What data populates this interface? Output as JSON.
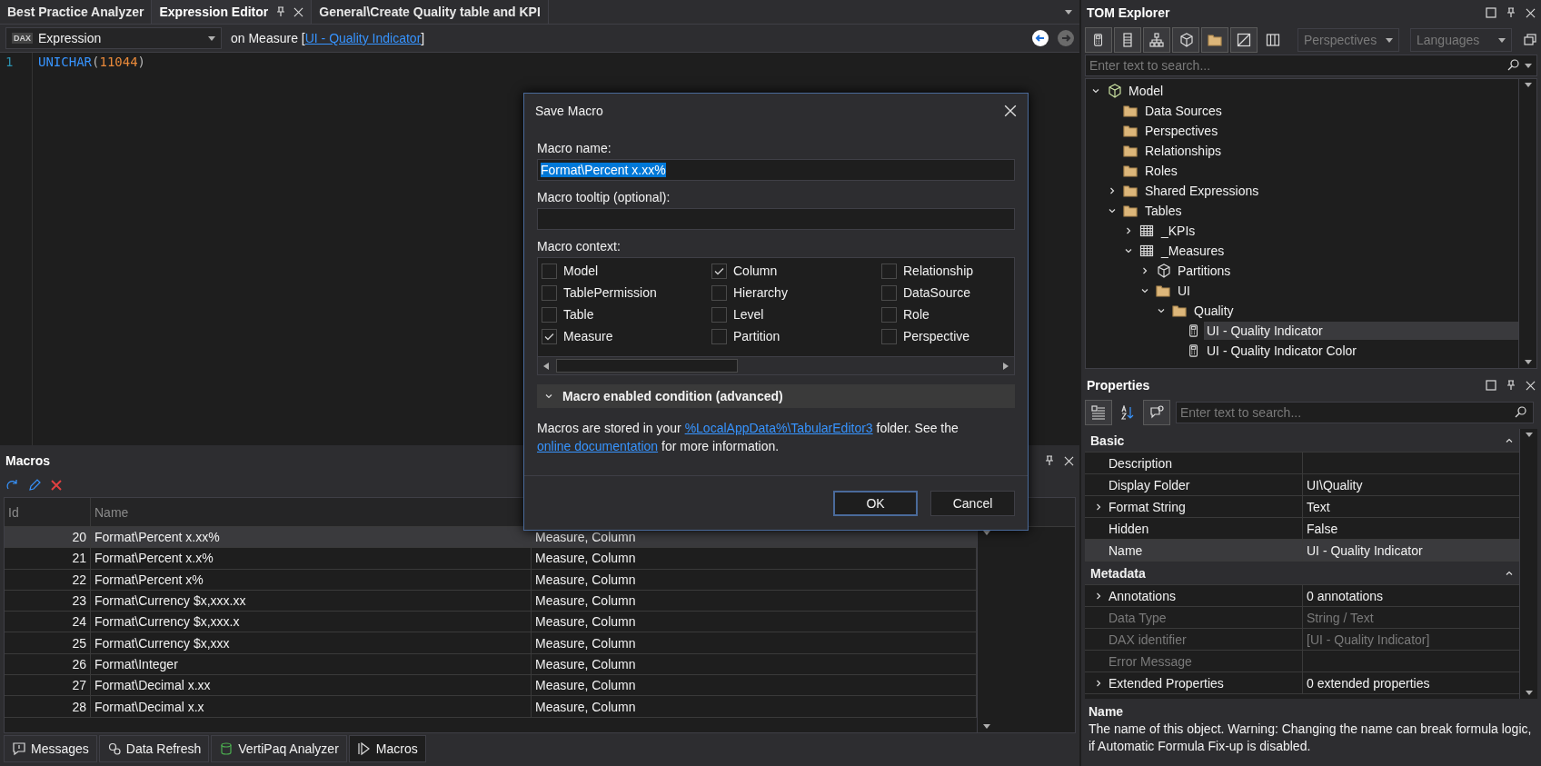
{
  "document_tabs": [
    {
      "label": "Best Practice Analyzer",
      "selected": false,
      "kind": "plain"
    },
    {
      "label": "Expression Editor",
      "selected": true,
      "kind": "pinned"
    },
    {
      "label": "General\\Create Quality table and KPI",
      "selected": false,
      "kind": "plain"
    }
  ],
  "editor": {
    "badge": "DAX",
    "property": "Expression",
    "context_prefix": "on Measure [",
    "context_link": "UI - Quality Indicator",
    "context_suffix": "]",
    "nav_buttons": [
      {
        "kind": "back",
        "disabled": false
      },
      {
        "kind": "forward",
        "disabled": true
      }
    ],
    "lines": [
      {
        "number": "1",
        "tokens": [
          {
            "text": "UNICHAR",
            "kind": "function"
          },
          {
            "text": "(",
            "kind": "paren"
          },
          {
            "text": "11044",
            "kind": "number"
          },
          {
            "text": ")",
            "kind": "paren"
          }
        ]
      }
    ]
  },
  "macros": {
    "title": "Macros",
    "columns": [
      "Id",
      "Name"
    ],
    "rows": [
      {
        "id": "20",
        "name": "Format\\Percent x.xx%",
        "context": "Measure, Column",
        "selected": true
      },
      {
        "id": "21",
        "name": "Format\\Percent x.x%",
        "context": "Measure, Column",
        "selected": false
      },
      {
        "id": "22",
        "name": "Format\\Percent x%",
        "context": "Measure, Column",
        "selected": false
      },
      {
        "id": "23",
        "name": "Format\\Currency $x,xxx.xx",
        "context": "Measure, Column",
        "selected": false
      },
      {
        "id": "24",
        "name": "Format\\Currency $x,xxx.x",
        "context": "Measure, Column",
        "selected": false
      },
      {
        "id": "25",
        "name": "Format\\Currency $x,xxx",
        "context": "Measure, Column",
        "selected": false
      },
      {
        "id": "26",
        "name": "Format\\Integer",
        "context": "Measure, Column",
        "selected": false
      },
      {
        "id": "27",
        "name": "Format\\Decimal x.xx",
        "context": "Measure, Column",
        "selected": false
      },
      {
        "id": "28",
        "name": "Format\\Decimal x.x",
        "context": "Measure, Column",
        "selected": false
      }
    ]
  },
  "bottom_tabs": [
    {
      "label": "Messages",
      "kind": "messages",
      "selected": false
    },
    {
      "label": "Data Refresh",
      "kind": "refresh",
      "selected": false
    },
    {
      "label": "VertiPaq Analyzer",
      "kind": "vertipaq",
      "selected": false
    },
    {
      "label": "Macros",
      "kind": "macros",
      "selected": true
    }
  ],
  "dialog": {
    "title": "Save Macro",
    "name_label": "Macro name:",
    "name_value": "Format\\Percent x.xx%",
    "name_value_selected": true,
    "tooltip_label": "Macro tooltip (optional):",
    "context_label": "Macro context:",
    "contexts": [
      {
        "label": "Model",
        "checked": false
      },
      {
        "label": "Column",
        "checked": true
      },
      {
        "label": "Relationship",
        "checked": false
      },
      {
        "label": "TablePermission",
        "checked": false
      },
      {
        "label": "Hierarchy",
        "checked": false
      },
      {
        "label": "DataSource",
        "checked": false
      },
      {
        "label": "Table",
        "checked": false
      },
      {
        "label": "Level",
        "checked": false
      },
      {
        "label": "Role",
        "checked": false
      },
      {
        "label": "Measure",
        "checked": true
      },
      {
        "label": "Partition",
        "checked": false
      },
      {
        "label": "Perspective",
        "checked": false
      }
    ],
    "condition": {
      "label": "Macro enabled condition (advanced)",
      "expanded": false
    },
    "info": [
      {
        "kind": "text",
        "text": "Macros are stored in your "
      },
      {
        "kind": "link",
        "text": "%LocalAppData%\\TabularEditor3"
      },
      {
        "kind": "text",
        "text": " folder. See the "
      },
      {
        "kind": "link",
        "text": "online documentation"
      },
      {
        "kind": "text",
        "text": " for more information."
      }
    ],
    "buttons": [
      {
        "label": "OK",
        "default": true
      },
      {
        "label": "Cancel",
        "default": false
      }
    ]
  },
  "tom_explorer": {
    "title": "TOM Explorer",
    "view_buttons": [
      {
        "kind": "measure",
        "selected": true
      },
      {
        "kind": "column",
        "selected": true
      },
      {
        "kind": "hierarchy",
        "selected": true
      },
      {
        "kind": "partition",
        "selected": true
      },
      {
        "kind": "folder",
        "selected": true
      },
      {
        "kind": "hidden",
        "selected": true
      },
      {
        "kind": "columns",
        "selected": false
      }
    ],
    "perspectives_placeholder": "Perspectives",
    "languages_placeholder": "Languages",
    "search_placeholder": "Enter text to search...",
    "tree": [
      {
        "label": "Model",
        "kind": "model",
        "expanded": true,
        "selected": false,
        "children": [
          {
            "label": "Data Sources",
            "kind": "folder",
            "selected": false
          },
          {
            "label": "Perspectives",
            "kind": "folder",
            "selected": false
          },
          {
            "label": "Relationships",
            "kind": "folder",
            "selected": false
          },
          {
            "label": "Roles",
            "kind": "folder",
            "selected": false
          },
          {
            "label": "Shared Expressions",
            "kind": "folder",
            "expanded": false,
            "selected": false
          },
          {
            "label": "Tables",
            "kind": "folder",
            "expanded": true,
            "selected": false,
            "children": [
              {
                "label": "_KPIs",
                "kind": "table",
                "expanded": false,
                "selected": false
              },
              {
                "label": "_Measures",
                "kind": "table",
                "expanded": true,
                "selected": false,
                "children": [
                  {
                    "label": "Partitions",
                    "kind": "partition",
                    "expanded": false,
                    "selected": false
                  },
                  {
                    "label": "UI",
                    "kind": "folder",
                    "expanded": true,
                    "selected": false,
                    "children": [
                      {
                        "label": "Quality",
                        "kind": "folder",
                        "expanded": true,
                        "selected": false,
                        "children": [
                          {
                            "label": "UI - Quality Indicator",
                            "kind": "measure",
                            "selected": true
                          },
                          {
                            "label": "UI - Quality Indicator Color",
                            "kind": "measure",
                            "selected": false
                          }
                        ]
                      }
                    ]
                  }
                ]
              }
            ]
          }
        ]
      }
    ]
  },
  "properties": {
    "title": "Properties",
    "view_buttons": [
      {
        "kind": "categorized",
        "selected": true
      },
      {
        "kind": "alphabetical",
        "selected": false
      },
      {
        "kind": "description",
        "selected": true
      }
    ],
    "search_placeholder": "Enter text to search...",
    "sections": [
      {
        "title": "Basic",
        "expanded": true,
        "rows": [
          {
            "name": "Description",
            "value": "",
            "expandable": false,
            "disabled": false,
            "selected": false
          },
          {
            "name": "Display Folder",
            "value": "UI\\Quality",
            "expandable": false,
            "disabled": false,
            "selected": false
          },
          {
            "name": "Format String",
            "value": "Text",
            "expandable": true,
            "disabled": false,
            "selected": false
          },
          {
            "name": "Hidden",
            "value": "False",
            "expandable": false,
            "disabled": false,
            "selected": false
          },
          {
            "name": "Name",
            "value": "UI - Quality Indicator",
            "expandable": false,
            "disabled": false,
            "selected": true
          }
        ]
      },
      {
        "title": "Metadata",
        "expanded": true,
        "rows": [
          {
            "name": "Annotations",
            "value": "0 annotations",
            "expandable": true,
            "disabled": false,
            "selected": false
          },
          {
            "name": "Data Type",
            "value": "String / Text",
            "expandable": false,
            "disabled": true,
            "selected": false
          },
          {
            "name": "DAX identifier",
            "value": "[UI - Quality Indicator]",
            "expandable": false,
            "disabled": true,
            "selected": false
          },
          {
            "name": "Error Message",
            "value": "",
            "expandable": false,
            "disabled": true,
            "selected": false
          },
          {
            "name": "Extended Properties",
            "value": "0 extended properties",
            "expandable": true,
            "disabled": false,
            "selected": false
          }
        ]
      }
    ],
    "description": {
      "title": "Name",
      "text": "The name of this object. Warning: Changing the name can break formula logic, if Automatic Formula Fix-up is disabled."
    }
  }
}
